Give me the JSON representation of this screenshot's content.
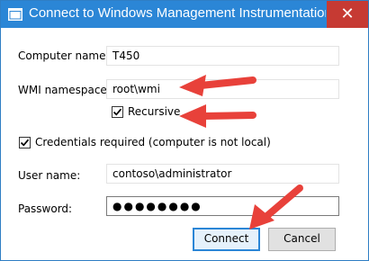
{
  "window": {
    "title": "Connect to Windows Management Instrumentation",
    "close_glyph": "✕"
  },
  "form": {
    "computer_name": {
      "label": "Computer name:",
      "value": "T450"
    },
    "wmi_namespace": {
      "label": "WMI namespace:",
      "value": "root\\wmi"
    },
    "recursive": {
      "label": "Recursive",
      "checked": true
    },
    "credentials_required": {
      "label": "Credentials required (computer is not local)",
      "checked": true
    },
    "user_name": {
      "label": "User name:",
      "value": "contoso\\administrator"
    },
    "password": {
      "label": "Password:",
      "value": "●●●●●●●●"
    }
  },
  "buttons": {
    "connect": "Connect",
    "cancel": "Cancel"
  },
  "colors": {
    "title_bar": "#2b86d6",
    "close_button": "#c63a33",
    "annotation_arrow": "#e8413a"
  },
  "icons": [
    "app-window-icon",
    "close-icon",
    "checkmark-icon",
    "annotation-arrow"
  ]
}
